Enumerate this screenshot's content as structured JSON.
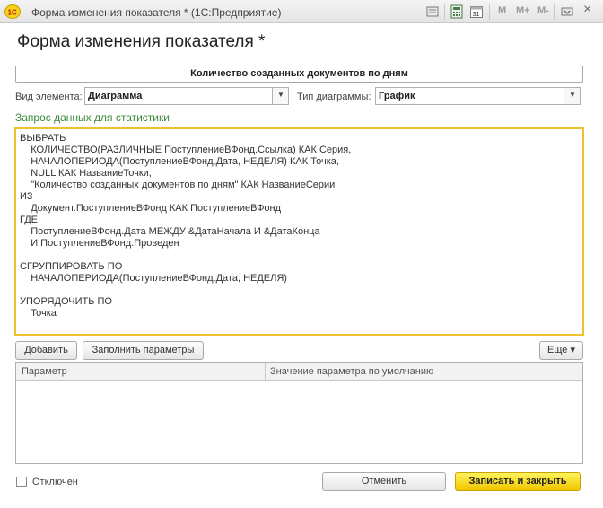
{
  "window": {
    "title": "Форма изменения показателя * (1С:Предприятие)",
    "logo_text": "1С",
    "calendar_day": "31",
    "mem_buttons": [
      "M",
      "M+",
      "M-"
    ],
    "close_glyph": "×"
  },
  "form": {
    "title": "Форма изменения показателя *",
    "document_name": "Количество созданных документов по дням",
    "element_type_label": "Вид элемента:",
    "element_type_value": "Диаграмма",
    "chart_type_label": "Тип диаграммы:",
    "chart_type_value": "График",
    "query_section_title": "Запрос данных для статистики",
    "query_text": "ВЫБРАТЬ\n    КОЛИЧЕСТВО(РАЗЛИЧНЫЕ ПоступлениеВФонд.Ссылка) КАК Серия,\n    НАЧАЛОПЕРИОДА(ПоступлениеВФонд.Дата, НЕДЕЛЯ) КАК Точка,\n    NULL КАК НазваниеТочки,\n    \"Количество созданных документов по дням\" КАК НазваниеСерии\nИЗ\n    Документ.ПоступлениеВФонд КАК ПоступлениеВФонд\nГДЕ\n    ПоступлениеВФонд.Дата МЕЖДУ &ДатаНачала И &ДатаКонца\n    И ПоступлениеВФонд.Проведен\n\nСГРУППИРОВАТЬ ПО\n    НАЧАЛОПЕРИОДА(ПоступлениеВФонд.Дата, НЕДЕЛЯ)\n\nУПОРЯДОЧИТЬ ПО\n    Точка"
  },
  "toolbar": {
    "add_label": "Добавить",
    "fill_params_label": "Заполнить параметры",
    "more_label": "Еще",
    "more_arrow": "▾"
  },
  "params_table": {
    "columns": [
      "Параметр",
      "Значение параметра по умолчанию"
    ],
    "rows": []
  },
  "footer": {
    "disabled_label": "Отключен",
    "disabled_checked": false,
    "cancel_label": "Отменить",
    "save_close_label": "Записать и закрыть"
  },
  "icons": {
    "dropdown": "▼"
  },
  "colors": {
    "accent_yellow": "#f2c500",
    "query_border": "#f0c030",
    "section_title": "#3a8a3a"
  }
}
